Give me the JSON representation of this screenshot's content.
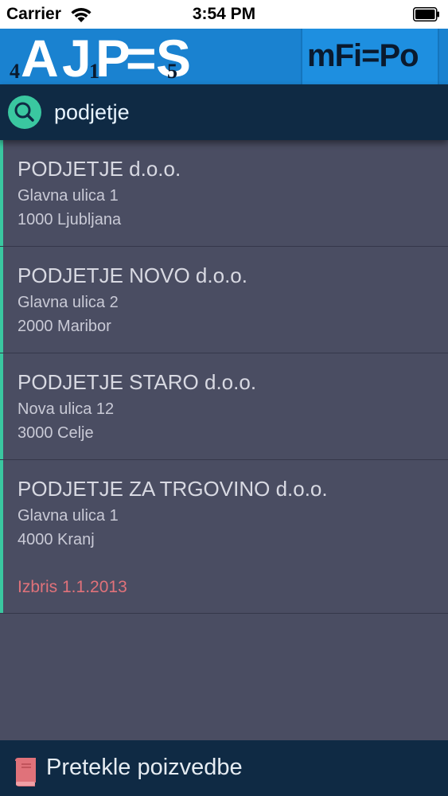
{
  "status_bar": {
    "carrier": "Carrier",
    "time": "3:54 PM"
  },
  "header": {
    "logo_left": {
      "letters": [
        "A",
        "J",
        "P",
        "=",
        "S"
      ],
      "digits": [
        "4",
        "1",
        "5"
      ]
    },
    "logo_right": "mFi=Po"
  },
  "search": {
    "value": "podjetje",
    "placeholder": ""
  },
  "results": [
    {
      "name": "PODJETJE d.o.o.",
      "street": "Glavna ulica 1",
      "city": "1000 Ljubljana",
      "note": ""
    },
    {
      "name": "PODJETJE NOVO d.o.o.",
      "street": "Glavna ulica 2",
      "city": "2000 Maribor",
      "note": ""
    },
    {
      "name": "PODJETJE STARO d.o.o.",
      "street": "Nova ulica 12",
      "city": "3000 Celje",
      "note": ""
    },
    {
      "name": "PODJETJE ZA TRGOVINO d.o.o.",
      "street": "Glavna ulica 1",
      "city": "4000 Kranj",
      "note": "Izbris 1.1.2013"
    }
  ],
  "bottom_bar": {
    "label": "Pretekle poizvedbe",
    "icon": "book-icon"
  },
  "colors": {
    "header_bg": "#1a82d0",
    "search_bg": "#0f2a44",
    "list_bg": "#4a4d62",
    "accent": "#3ac7a0",
    "deleted_note": "#e0727a"
  }
}
